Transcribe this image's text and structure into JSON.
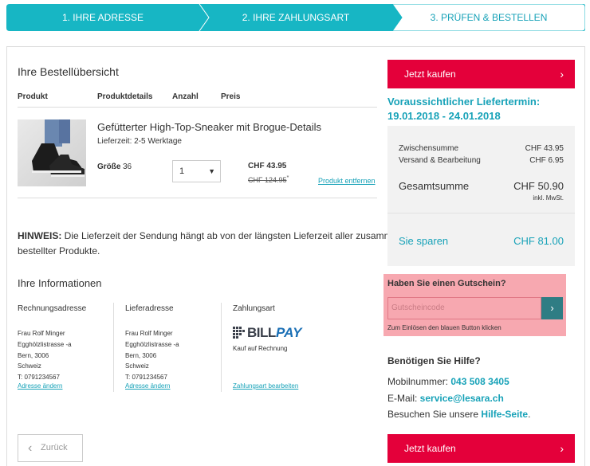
{
  "stepper": {
    "step1": "1. IHRE ADRESSE",
    "step2": "2. IHRE ZAHLUNGSART",
    "step3": "3. PRÜFEN & BESTELLEN"
  },
  "order": {
    "title": "Ihre Bestellübersicht",
    "columns": {
      "product": "Produkt",
      "details": "Produktdetails",
      "quantity": "Anzahl",
      "price": "Preis"
    },
    "item": {
      "name": "Gefütterter High-Top-Sneaker mit Brogue-Details",
      "delivery_time": "Lieferzeit: 2-5 Werktage",
      "size_label": "Größe",
      "size_value": "36",
      "quantity": "1",
      "price": "CHF 43.95",
      "old_price": "CHF 124.95",
      "old_price_mark": "*",
      "remove_label": "Produkt entfernen"
    },
    "notice_label": "HINWEIS:",
    "notice_text_1": " Die Lieferzeit der Sendung hängt ab von der längsten Lieferzeit aller zusammen",
    "notice_text_2": "bestellter Produkte."
  },
  "info": {
    "title": "Ihre Informationen",
    "billing": {
      "heading": "Rechnungsadresse",
      "name": "Frau Rolf Minger",
      "street": "Egghölzlistrasse -a",
      "city": "Bern, 3006",
      "country": "Schweiz",
      "phone": "T: 0791234567",
      "edit": "Adresse ändern"
    },
    "shipping": {
      "heading": "Lieferadresse",
      "name": "Frau Rolf Minger",
      "street": "Egghölzlistrasse -a",
      "city": "Bern, 3006",
      "country": "Schweiz",
      "phone": "T: 0791234567",
      "edit": "Adresse ändern"
    },
    "payment": {
      "heading": "Zahlungsart",
      "logo_bill": "BILL",
      "logo_pay": "PAY",
      "method": "Kauf auf Rechnung",
      "edit": "Zahlungsart bearbeiten"
    }
  },
  "back_label": "Zurück",
  "sidebar": {
    "buy_label": "Jetzt kaufen",
    "delivery_heading": "Voraussichtlicher Liefertermin:",
    "delivery_dates": "19.01.2018 - 24.01.2018",
    "subtotal_label": "Zwischensumme",
    "subtotal_value": "CHF 43.95",
    "shipping_label": "Versand & Bearbeitung",
    "shipping_value": "CHF 6.95",
    "total_label": "Gesamtsumme",
    "total_value": "CHF 50.90",
    "vat_note": "inkl. MwSt.",
    "savings_label": "Sie sparen",
    "savings_value": "CHF 81.00",
    "voucher_heading": "Haben Sie einen Gutschein?",
    "voucher_placeholder": "Gutscheincode",
    "voucher_hint": "Zum Einlösen den blauen Button klicken",
    "help_heading": "Benötigen Sie Hilfe?",
    "phone_label": "Mobilnummer: ",
    "phone_value": "043 508 3405",
    "email_label": "E-Mail: ",
    "email_value": "service@lesara.ch",
    "visit_label": "Besuchen Sie unsere ",
    "visit_link": "Hilfe-Seite",
    "visit_end": "."
  },
  "colors": {
    "accent": "#17a2b8",
    "buy": "#e4003a",
    "voucher_bg": "#f7a8b0"
  }
}
